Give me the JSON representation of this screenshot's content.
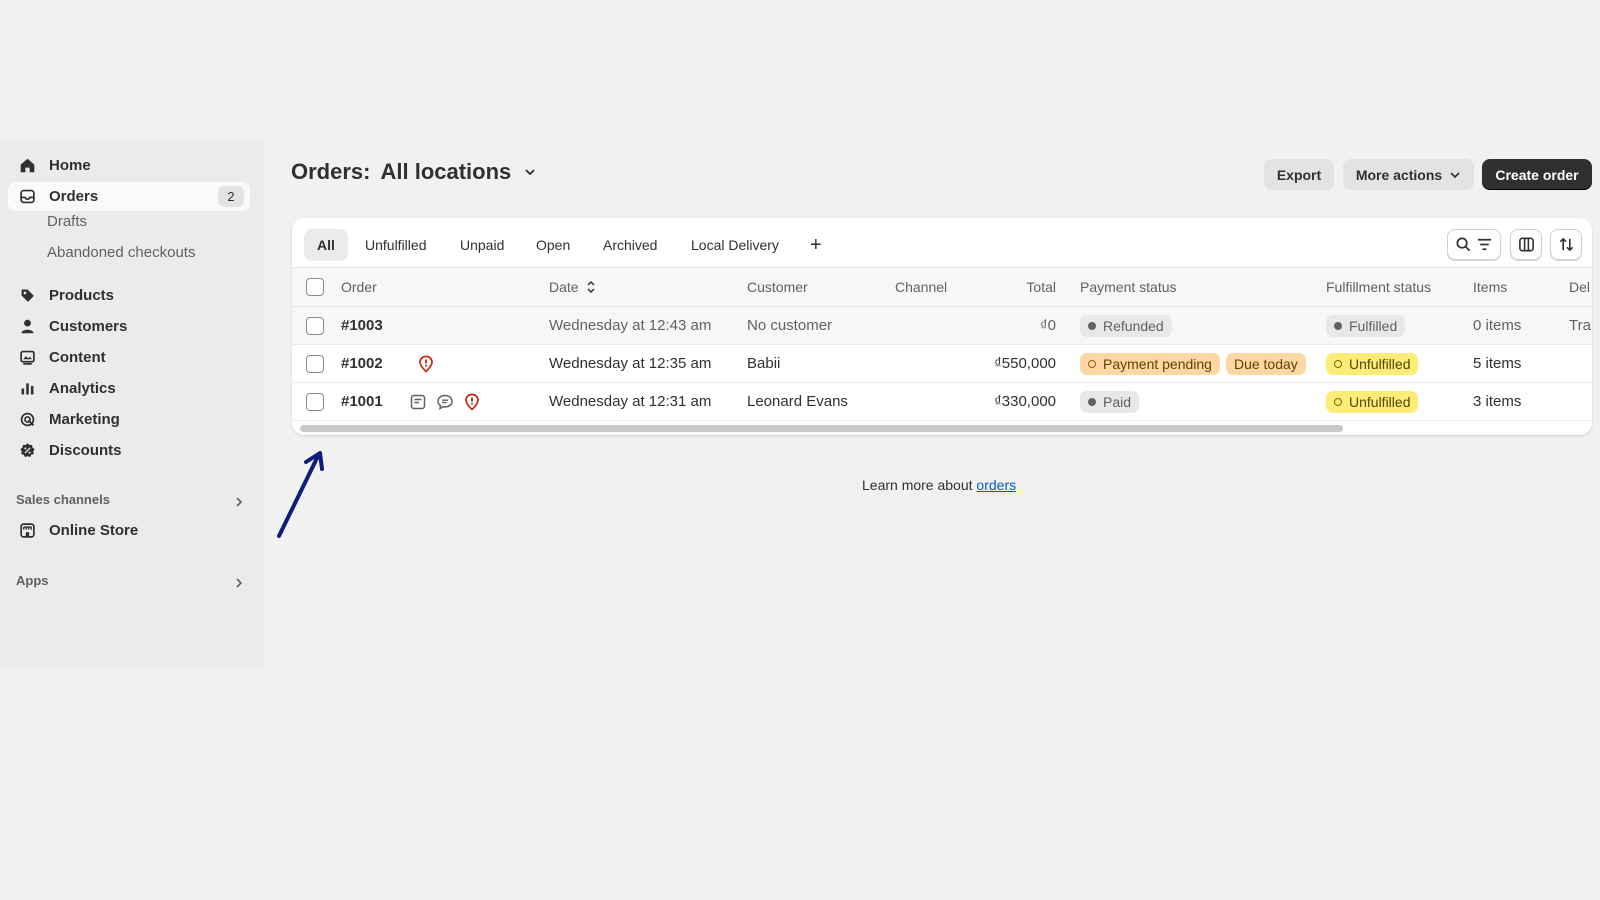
{
  "sidebar": {
    "items": [
      {
        "label": "Home",
        "icon": "home-icon"
      },
      {
        "label": "Orders",
        "icon": "inbox-icon",
        "badge": "2"
      },
      {
        "label": "Products",
        "icon": "tag-icon"
      },
      {
        "label": "Customers",
        "icon": "person-icon"
      },
      {
        "label": "Content",
        "icon": "image-icon"
      },
      {
        "label": "Analytics",
        "icon": "bar-chart-icon"
      },
      {
        "label": "Marketing",
        "icon": "target-icon"
      },
      {
        "label": "Discounts",
        "icon": "discount-icon"
      }
    ],
    "sub_items": [
      "Drafts",
      "Abandoned checkouts"
    ],
    "sales_channels_label": "Sales channels",
    "online_store_label": "Online Store",
    "apps_label": "Apps"
  },
  "header": {
    "title": "Orders:",
    "location": "All locations",
    "export_label": "Export",
    "more_actions_label": "More actions",
    "create_label": "Create order"
  },
  "tabs": [
    "All",
    "Unfulfilled",
    "Unpaid",
    "Open",
    "Archived",
    "Local Delivery",
    "+"
  ],
  "table": {
    "columns": [
      "Order",
      "Date",
      "Customer",
      "Channel",
      "Total",
      "Payment status",
      "Fulfillment status",
      "Items",
      "Del"
    ],
    "rows": [
      {
        "order": "#1003",
        "date": "Wednesday at 12:43 am",
        "customer": "No customer",
        "channel": "",
        "total": "₫0",
        "payment": [
          "Refunded"
        ],
        "fulfillment": "Fulfilled",
        "items": "0 items",
        "delivery": "Tra"
      },
      {
        "order": "#1002",
        "date": "Wednesday at 12:35 am",
        "customer": "Babii",
        "channel": "",
        "total": "₫550,000",
        "payment": [
          "Payment pending",
          "Due today"
        ],
        "fulfillment": "Unfulfilled",
        "items": "5 items",
        "delivery": ""
      },
      {
        "order": "#1001",
        "date": "Wednesday at 12:31 am",
        "customer": "Leonard Evans",
        "channel": "",
        "total": "₫330,000",
        "payment": [
          "Paid"
        ],
        "fulfillment": "Unfulfilled",
        "items": "3 items",
        "delivery": ""
      }
    ]
  },
  "footer": {
    "learn_text": "Learn more about",
    "learn_link": "orders"
  },
  "colors": {
    "primary_button": "#303030",
    "link": "#005bd3",
    "badge_orange": "#ffd6a4",
    "badge_yellow": "#ffeb78",
    "alert_red": "#c5280c",
    "annotation_arrow": "#0b1e7a"
  }
}
